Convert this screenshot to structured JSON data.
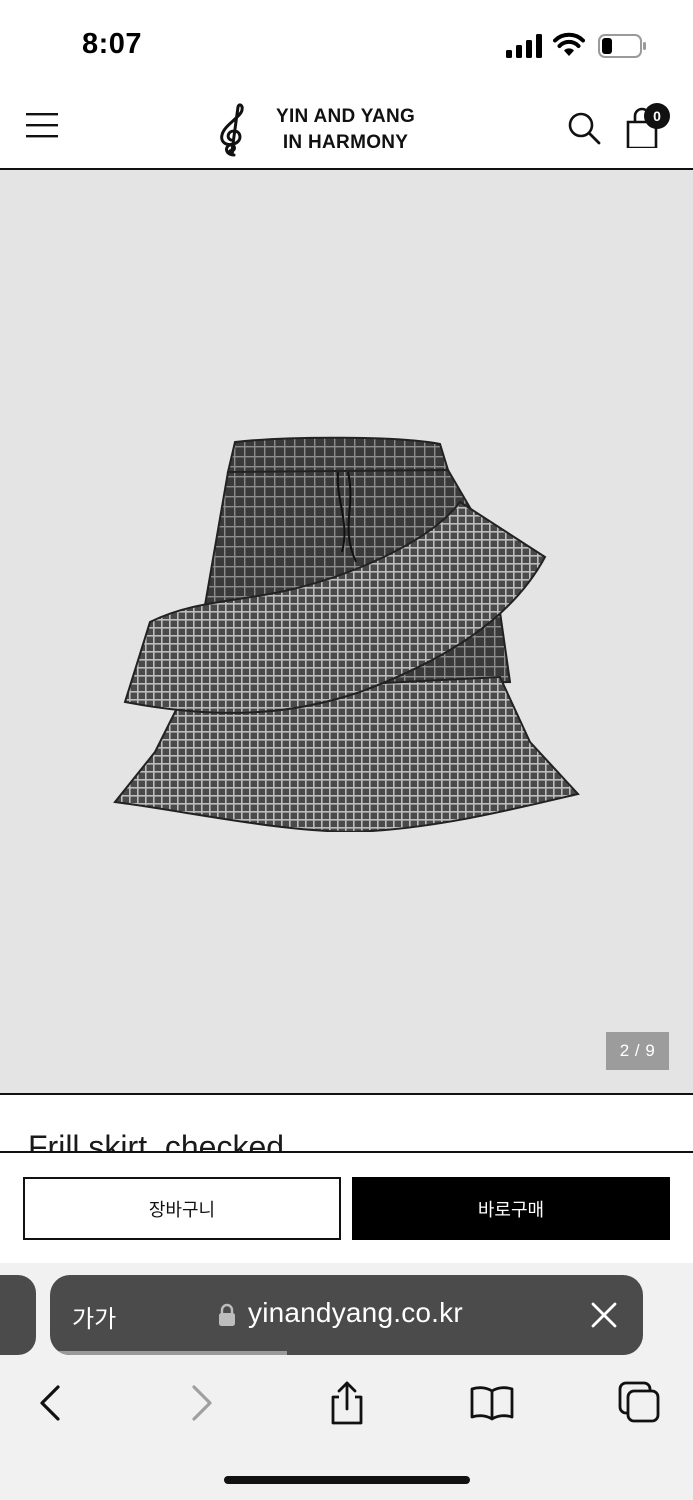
{
  "status_bar": {
    "time": "8:07",
    "signal_icon": "cellular-signal-icon",
    "wifi_icon": "wifi-icon",
    "battery_icon": "battery-icon"
  },
  "header": {
    "menu_icon": "hamburger-menu-icon",
    "logo_icon": "treble-clef-icon",
    "brand_line1": "YIN AND YANG",
    "brand_line2": "IN HARMONY",
    "search_icon": "search-icon",
    "cart_icon": "shopping-bag-icon",
    "cart_count": "0"
  },
  "gallery": {
    "image_description_icon": "checked-frill-skirt-photo",
    "counter": "2 / 9",
    "current": 2,
    "total": 9
  },
  "product": {
    "title": "Frill skirt_checked"
  },
  "actions": {
    "add_to_cart": "장바구니",
    "buy_now": "바로구매"
  },
  "safari": {
    "text_size_label": "가가",
    "lock_icon": "lock-icon",
    "url": "yinandyang.co.kr",
    "close_icon": "close-icon",
    "load_progress": 0.4,
    "toolbar": {
      "back_icon": "chevron-left-icon",
      "forward_icon": "chevron-right-icon",
      "share_icon": "share-icon",
      "bookmarks_icon": "open-book-icon",
      "tabs_icon": "tabs-icon"
    }
  },
  "colors": {
    "gallery_background": "#e4e4e4",
    "primary_black": "#000000",
    "counter_background": "#9c9c9c",
    "safari_pill": "#4b4b4b"
  }
}
